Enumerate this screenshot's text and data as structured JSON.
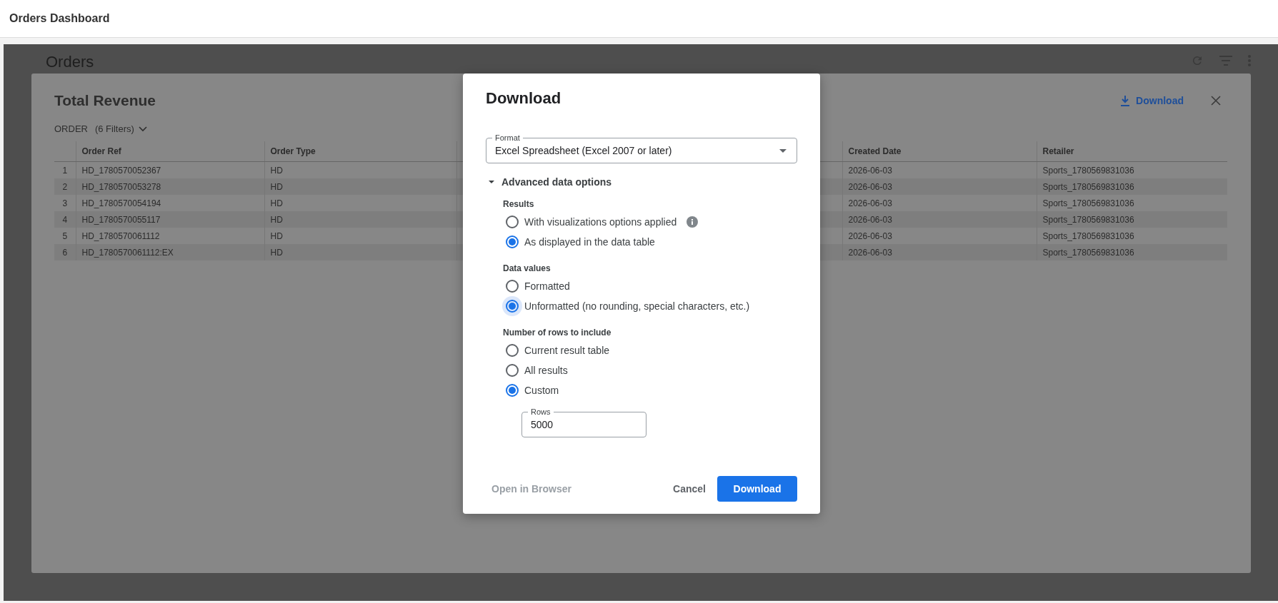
{
  "app_bar": {
    "title": "Orders Dashboard"
  },
  "page": {
    "title": "Orders"
  },
  "panel": {
    "title": "Total Revenue",
    "filter": {
      "label": "ORDER",
      "count": "(6 Filters)"
    },
    "download_link": "Download",
    "table": {
      "columns": [
        "Order Ref",
        "Order Type",
        "Created Date",
        "Retailer"
      ],
      "rows": [
        {
          "index": "1",
          "cells": [
            "HD_1780570052367",
            "HD",
            "2026-06-03",
            "Sports_1780569831036"
          ]
        },
        {
          "index": "2",
          "cells": [
            "HD_1780570053278",
            "HD",
            "2026-06-03",
            "Sports_1780569831036"
          ]
        },
        {
          "index": "3",
          "cells": [
            "HD_1780570054194",
            "HD",
            "2026-06-03",
            "Sports_1780569831036"
          ]
        },
        {
          "index": "4",
          "cells": [
            "HD_1780570055117",
            "HD",
            "2026-06-03",
            "Sports_1780569831036"
          ]
        },
        {
          "index": "5",
          "cells": [
            "HD_1780570061112",
            "HD",
            "2026-06-03",
            "Sports_1780569831036"
          ]
        },
        {
          "index": "6",
          "cells": [
            "HD_1780570061112:EX",
            "HD",
            "2026-06-03",
            "Sports_1780569831036"
          ]
        }
      ]
    }
  },
  "dialog": {
    "title": "Download",
    "format": {
      "label": "Format",
      "value": "Excel Spreadsheet (Excel 2007 or later)"
    },
    "advanced": {
      "label": "Advanced data options",
      "expanded": true
    },
    "groups": [
      {
        "label": "Results",
        "options": [
          {
            "label": "With visualizations options applied",
            "selected": false,
            "focused": false,
            "info": true
          },
          {
            "label": "As displayed in the data table",
            "selected": true,
            "focused": false,
            "info": false
          }
        ]
      },
      {
        "label": "Data values",
        "options": [
          {
            "label": "Formatted",
            "selected": false,
            "focused": false,
            "info": false
          },
          {
            "label": "Unformatted (no rounding, special characters, etc.)",
            "selected": true,
            "focused": true,
            "info": false
          }
        ]
      },
      {
        "label": "Number of rows to include",
        "options": [
          {
            "label": "Current result table",
            "selected": false,
            "focused": false,
            "info": false
          },
          {
            "label": "All results",
            "selected": false,
            "focused": false,
            "info": false
          },
          {
            "label": "Custom",
            "selected": true,
            "focused": false,
            "info": false
          }
        ],
        "rows_field": {
          "label": "Rows",
          "value": "5000"
        }
      }
    ],
    "buttons": [
      {
        "label": "Open in Browser",
        "kind": "text",
        "disabled": true
      },
      {
        "label": "Cancel",
        "kind": "text",
        "disabled": false
      },
      {
        "label": "Download",
        "kind": "primary",
        "disabled": false
      }
    ]
  }
}
